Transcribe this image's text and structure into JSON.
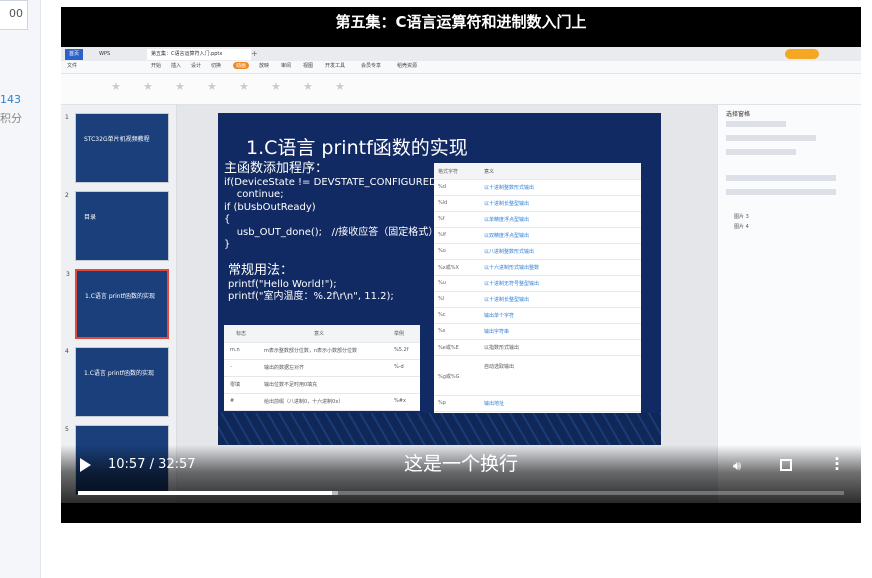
{
  "sidebar": {
    "top_value": "00",
    "count": "143",
    "suffix": "积分"
  },
  "video": {
    "title": "第五集：C语言运算符和进制数入门上",
    "subtitle": "这是一个换行",
    "time_label": "10:57 / 32:57",
    "progress": 0.332,
    "buffered": 0.34
  },
  "wps": {
    "tabs": {
      "home": "首页",
      "wps": "WPS",
      "doc": "第五集：C语言运算符入门.pptx"
    },
    "menu": [
      "文件",
      "开始",
      "插入",
      "设计",
      "切换",
      "动画",
      "放映",
      "审阅",
      "视图",
      "开发工具",
      "会员专享",
      "稻壳资源"
    ]
  },
  "thumbnails": [
    {
      "num": "1",
      "text": "STC32G单片机视频教程"
    },
    {
      "num": "2",
      "text": "目录"
    },
    {
      "num": "3",
      "text": "1.C语言 printf函数的实现"
    },
    {
      "num": "4",
      "text": "1.C语言 printf函数的实现"
    },
    {
      "num": "5",
      "text": ""
    }
  ],
  "slide": {
    "title": "1.C语言 printf函数的实现",
    "code_head": "主函数添加程序：",
    "code_lines": "if(DeviceState != DEVSTATE_CONFIGURED)\n    continue;\nif (bUsbOutReady)\n{\n    usb_OUT_done();   //接收应答（固定格式）\n}",
    "usage_head": "常规用法：",
    "usage_lines": "printf(\"Hello World!\");\nprintf(\"室内温度：%.2f\\r\\n\", 11.2);"
  },
  "format_table": {
    "headers": [
      "格式字符",
      "意义"
    ],
    "rows": [
      [
        "%d",
        "以十进制整数形式输出"
      ],
      [
        "%ld",
        "以十进制长整型输出"
      ],
      [
        "%f",
        "以单精度浮点型输出"
      ],
      [
        "%lf",
        "以双精度浮点型输出"
      ],
      [
        "%o",
        "以八进制整数形式输出"
      ],
      [
        "%x或%X",
        "以十六进制形式输出整数"
      ],
      [
        "%u",
        "以十进制无符号整型输出"
      ],
      [
        "%l",
        "以十进制长整型输出"
      ],
      [
        "%c",
        "输出单个字符"
      ],
      [
        "%s",
        "输出字符串"
      ],
      [
        "%e或%E",
        "以指数形式输出"
      ],
      [
        "%g或%G",
        "自动选取输出"
      ],
      [
        "%p",
        "输出地址"
      ]
    ]
  },
  "flag_table": {
    "headers": [
      "标志",
      "意义",
      "举例"
    ],
    "rows": [
      [
        "m.n",
        "m表示整数部分位数，n表示小数部分位数",
        "%5.2f"
      ],
      [
        "-",
        "输出的数据左对齐",
        "%-d"
      ],
      [
        "零填",
        "输出位数不足时用0填充",
        ""
      ],
      [
        "#",
        "给出前缀（八进制0，十六进制0x）",
        "%#x"
      ]
    ]
  },
  "right_panel": {
    "title": "选择窗格",
    "items": [
      "图片 3",
      "图片 4"
    ]
  }
}
